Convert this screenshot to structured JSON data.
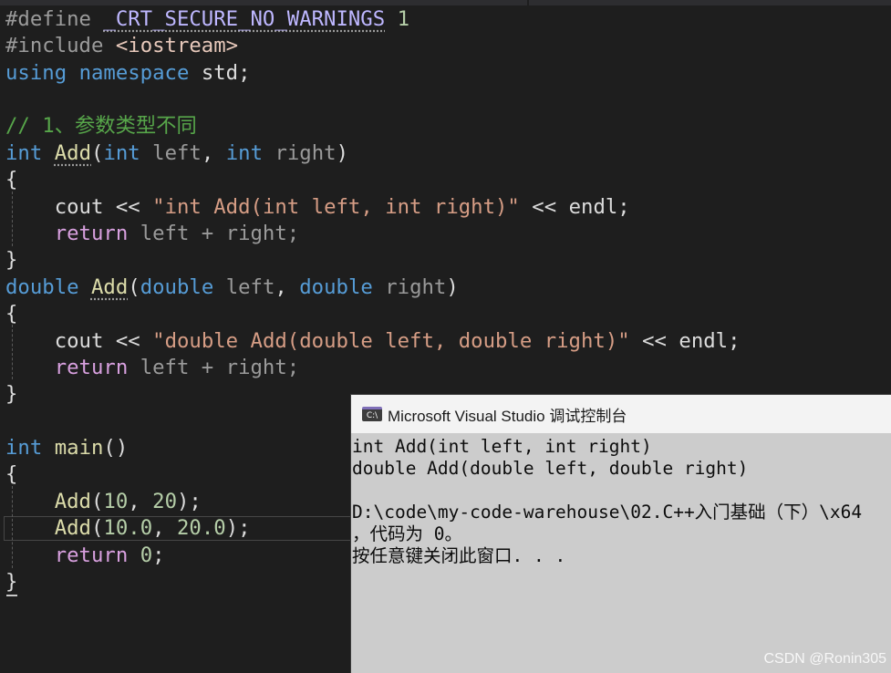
{
  "editor": {
    "line_define_kw": "#define",
    "line_define_macro": "_CRT_SECURE_NO_WARNINGS",
    "line_define_value": "1",
    "line_include_kw": "#include",
    "line_include_file": "<iostream>",
    "line_using_1": "using",
    "line_using_2": "namespace",
    "line_using_3": "std;",
    "comment": "// 1、参数类型不同",
    "cout": "cout",
    "op_ll": "<<",
    "endl": "endl",
    "str_int": "\"int Add(int left, int right)\"",
    "str_double": "\"double Add(double left, double right)\"",
    "return_kw": "return",
    "ret_expr": "left + right;",
    "kw_int": "int",
    "kw_double": "double",
    "fn_add": "Add",
    "fn_main": "main",
    "p_left": "left",
    "p_right": "right",
    "brace_open": "{",
    "brace_close": "}",
    "call1_a": "10",
    "call1_b": "20",
    "call2_a": "10.0",
    "call2_b": "20.0",
    "ret_zero": "0"
  },
  "console": {
    "title": "Microsoft Visual Studio 调试控制台",
    "icon": "console-app-icon",
    "icon_text": "C:\\",
    "lines": [
      "int Add(int left, int right)",
      "double Add(double left, double right)",
      "",
      "D:\\code\\my-code-warehouse\\02.C++入门基础（下）\\x64",
      "，代码为 0。",
      "按任意键关闭此窗口. . ."
    ]
  },
  "watermark": "CSDN @Ronin305"
}
